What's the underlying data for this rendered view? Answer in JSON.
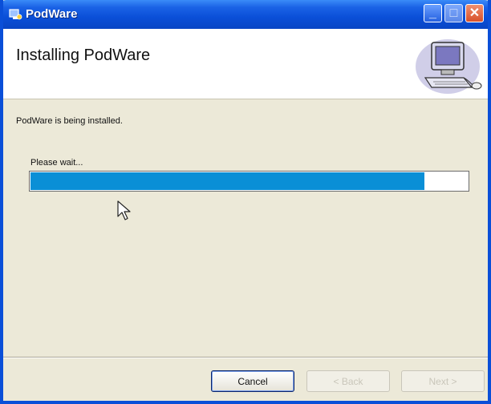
{
  "window": {
    "title": "PodWare",
    "controls": {
      "minimize": "minimize-icon",
      "maximize": "maximize-icon",
      "close": "close-icon"
    }
  },
  "header": {
    "title": "Installing PodWare",
    "graphic": "computer-icon"
  },
  "body": {
    "status": "PodWare is being installed.",
    "progress_label": "Please wait...",
    "progress_fraction": 0.9
  },
  "footer": {
    "cancel_label": "Cancel",
    "back_label": "< Back",
    "next_label": "Next >"
  },
  "colors": {
    "titlebar": "#0a4fd8",
    "progress_fill": "#0a8fd6",
    "dialog_bg": "#ece9d8"
  }
}
